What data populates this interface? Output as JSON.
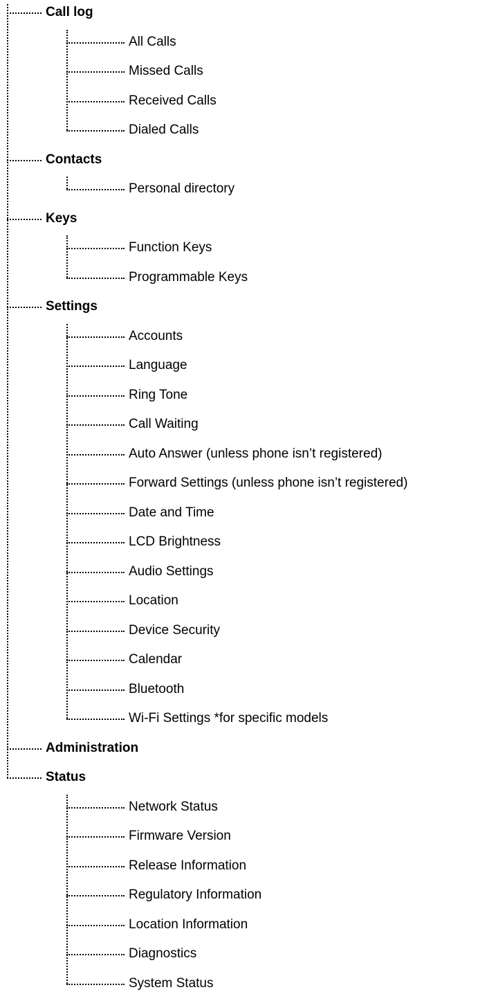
{
  "tree": [
    {
      "label": "Call log",
      "children": [
        "All Calls",
        "Missed Calls",
        "Received Calls",
        "Dialed Calls"
      ]
    },
    {
      "label": "Contacts",
      "children": [
        "Personal directory"
      ]
    },
    {
      "label": "Keys",
      "children": [
        "Function Keys",
        "Programmable Keys"
      ]
    },
    {
      "label": "Settings",
      "children": [
        "Accounts",
        "Language",
        "Ring Tone",
        "Call Waiting",
        "Auto Answer (unless phone isn’t registered)",
        "Forward Settings (unless phone isn’t registered)",
        "Date and Time",
        "LCD Brightness",
        "Audio Settings",
        "Location",
        "Device Security",
        "Calendar",
        "Bluetooth",
        "Wi-Fi Settings *for specific models"
      ]
    },
    {
      "label": "Administration",
      "children": []
    },
    {
      "label": "Status",
      "children": [
        "Network Status",
        "Firmware Version",
        "Release Information",
        "Regulatory Information",
        "Location Information",
        "Diagnostics",
        "System Status"
      ]
    }
  ]
}
